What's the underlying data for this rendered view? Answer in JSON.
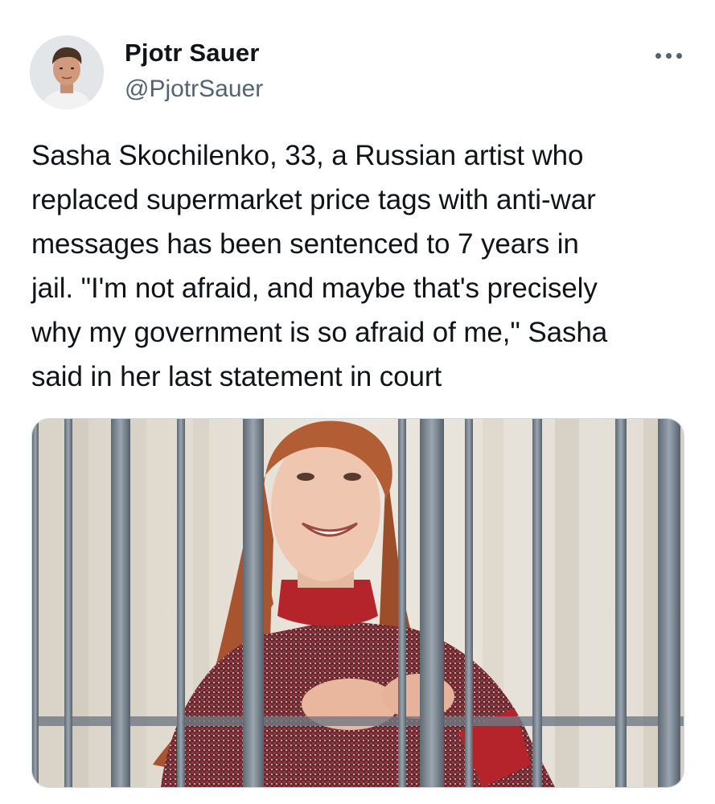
{
  "author": {
    "name": "Pjotr Sauer",
    "handle": "@PjotrSauer",
    "avatar_icon": "profile-photo"
  },
  "menu": {
    "icon": "more-horizontal-icon"
  },
  "tweet": {
    "text_lines": [
      "Sasha Skochilenko, 33, a Russian artist who",
      "replaced supermarket price tags with anti-war",
      "messages has been sentenced to 7 years in",
      "jail. \"I'm not afraid, and maybe that's precisely",
      "why my government is so afraid of me,\" Sasha",
      "said in her last statement in court"
    ]
  },
  "media": {
    "kind": "photo"
  },
  "colors": {
    "text_primary": "#0f1419",
    "text_secondary": "#536471",
    "background": "#ffffff",
    "media_border": "#cfd9de"
  }
}
